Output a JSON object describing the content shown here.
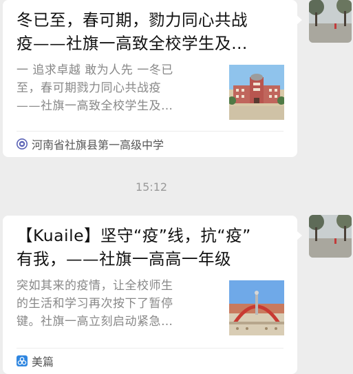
{
  "messages": [
    {
      "title_line1": "冬已至，春可期，勠力同心共战",
      "title_line2": "疫——社旗一高致全校学生及…",
      "desc_line1": "一 追求卓越 敢为人先 一冬已",
      "desc_line2": "至，春可期戮力同心共战疫",
      "desc_line3": "——社旗一高致全校学生及…",
      "source": "河南省社旗县第一高级中学",
      "source_icon": "school-seal-icon"
    },
    {
      "title_line1": "【Kuaile】坚守“疫”线，抗“疫”",
      "title_line2": "有我，——社旗一高高一年级",
      "desc_line1": "突如其来的疫情，让全校师生",
      "desc_line2": "的生活和学习再次按下了暂停",
      "desc_line3": "键。社旗一高立刻启动紧急…",
      "source": "美篇",
      "source_icon": "meipian-icon"
    }
  ],
  "timestamp": "15:12",
  "colors": {
    "background": "#ededed",
    "bubble": "#ffffff",
    "title": "#111111",
    "desc": "#888888",
    "source_icon_1": "#5a62b5",
    "source_icon_2": "#2f86e0"
  }
}
